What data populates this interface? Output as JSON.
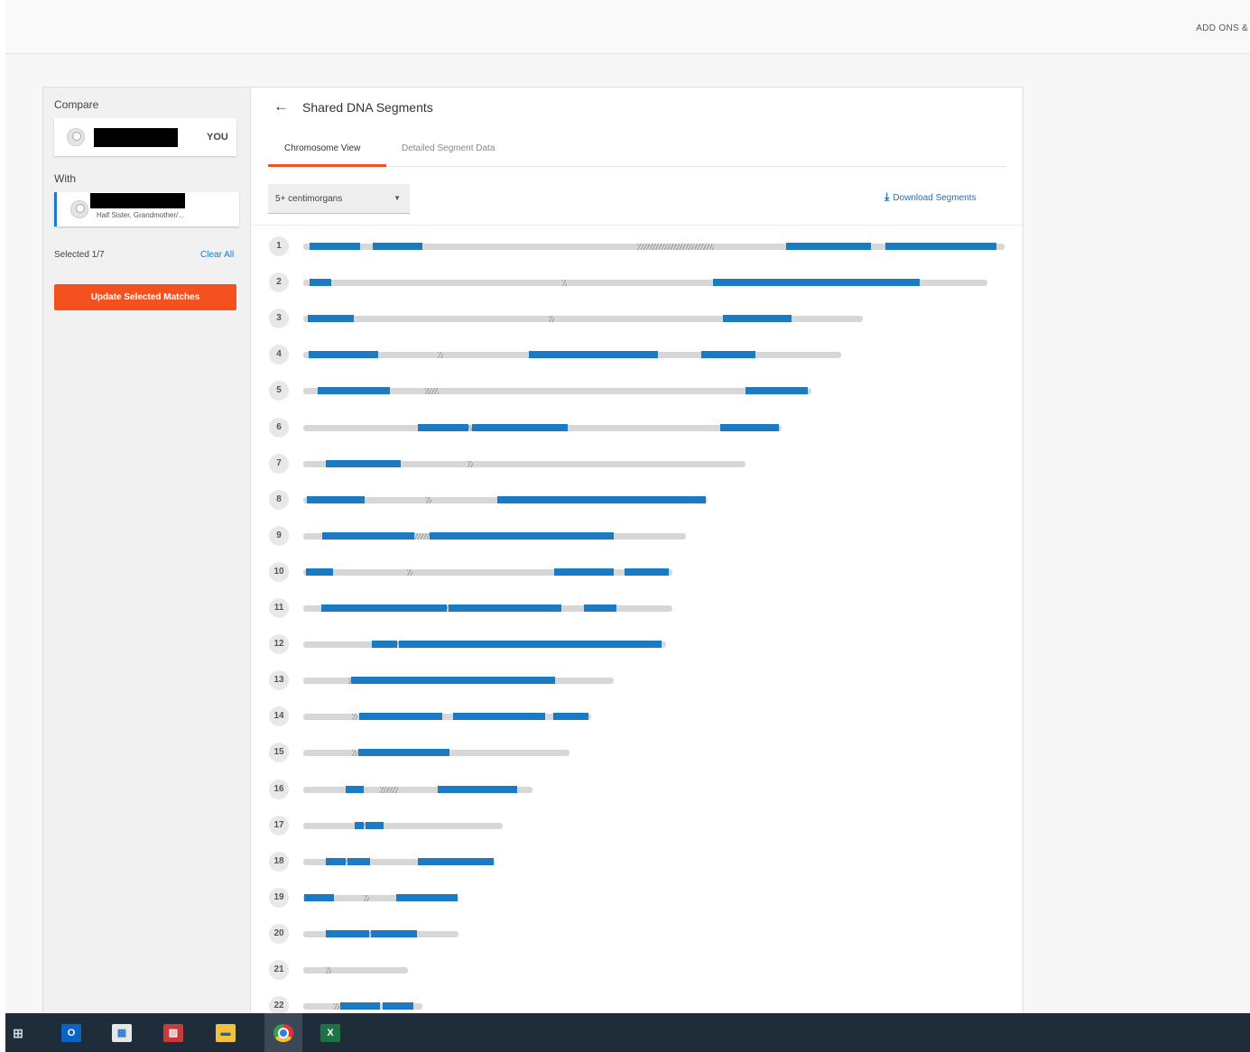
{
  "header": {
    "addons_label": "ADD ONS &"
  },
  "compare": {
    "compare_label": "Compare",
    "you_label": "YOU",
    "with_label": "With",
    "relationship": "Half Sister, Grandmother/...",
    "selected_count": "Selected 1/7",
    "clear_all": "Clear All",
    "update_button": "Update Selected Matches"
  },
  "main": {
    "title": "Shared DNA Segments",
    "tabs": [
      {
        "label": "Chromosome View"
      },
      {
        "label": "Detailed Segment Data"
      }
    ],
    "filter_value": "5+ centimorgans",
    "download_label": "Download Segments"
  },
  "icons": {
    "back": "arrow-left-icon",
    "dropdown": "caret-down-icon",
    "download": "download-icon"
  },
  "colors": {
    "accent": "#f4511e",
    "segment": "#1a7bc4",
    "link": "#1f7bc2"
  },
  "taskbar": {
    "outlook_label": "O",
    "excel_label": "X"
  },
  "chart_data": {
    "type": "chromosome-browser",
    "chromosomes": [
      {
        "label": "1",
        "length": 777,
        "centromere": [
          370,
          455
        ],
        "segments": [
          [
            7,
            63
          ],
          [
            77,
            132
          ],
          [
            535,
            629
          ],
          [
            645,
            768
          ]
        ]
      },
      {
        "label": "2",
        "length": 758,
        "centromere": [
          287,
          292
        ],
        "segments": [
          [
            7,
            31
          ],
          [
            454,
            683
          ]
        ]
      },
      {
        "label": "3",
        "length": 620,
        "centromere": [
          272,
          278
        ],
        "segments": [
          [
            5,
            56
          ],
          [
            465,
            541
          ]
        ]
      },
      {
        "label": "4",
        "length": 596,
        "centromere": [
          149,
          155
        ],
        "segments": [
          [
            6,
            83
          ],
          [
            250,
            393
          ],
          [
            441,
            501
          ]
        ]
      },
      {
        "label": "5",
        "length": 563,
        "centromere": [
          135,
          150
        ],
        "segments": [
          [
            16,
            96
          ],
          [
            490,
            559
          ]
        ]
      },
      {
        "label": "6",
        "length": 530,
        "centromere": [
          178,
          188
        ],
        "segments": [
          [
            127,
            183
          ],
          [
            187,
            293
          ],
          [
            462,
            527
          ]
        ]
      },
      {
        "label": "7",
        "length": 490,
        "centromere": [
          182,
          188
        ],
        "segments": [
          [
            25,
            108
          ]
        ]
      },
      {
        "label": "8",
        "length": 448,
        "centromere": [
          136,
          142
        ],
        "segments": [
          [
            4,
            68
          ],
          [
            215,
            446
          ]
        ]
      },
      {
        "label": "9",
        "length": 424,
        "centromere": [
          123,
          140
        ],
        "segments": [
          [
            21,
            123
          ],
          [
            140,
            344
          ]
        ]
      },
      {
        "label": "10",
        "length": 409,
        "centromere": [
          115,
          121
        ],
        "segments": [
          [
            3,
            33
          ],
          [
            278,
            344
          ],
          [
            356,
            405
          ]
        ]
      },
      {
        "label": "11",
        "length": 409,
        "centromere": [
          157,
          163
        ],
        "segments": [
          [
            20,
            159
          ],
          [
            161,
            286
          ],
          [
            311,
            347
          ]
        ]
      },
      {
        "label": "12",
        "length": 402,
        "centromere": [
          102,
          108
        ],
        "segments": [
          [
            76,
            104
          ],
          [
            106,
            397
          ]
        ]
      },
      {
        "label": "13",
        "length": 344,
        "centromere": [
          50,
          56
        ],
        "segments": [
          [
            53,
            279
          ]
        ]
      },
      {
        "label": "14",
        "length": 319,
        "centromere": [
          54,
          60
        ],
        "segments": [
          [
            62,
            154
          ],
          [
            166,
            268
          ],
          [
            277,
            316
          ]
        ]
      },
      {
        "label": "15",
        "length": 295,
        "centromere": [
          54,
          60
        ],
        "segments": [
          [
            61,
            162
          ]
        ]
      },
      {
        "label": "16",
        "length": 254,
        "centromere": [
          85,
          105
        ],
        "segments": [
          [
            47,
            67
          ],
          [
            149,
            237
          ]
        ]
      },
      {
        "label": "17",
        "length": 221,
        "centromere": [
          65,
          71
        ],
        "segments": [
          [
            57,
            67
          ],
          [
            69,
            89
          ]
        ]
      },
      {
        "label": "18",
        "length": 212,
        "centromere": [
          45,
          51
        ],
        "segments": [
          [
            25,
            47
          ],
          [
            49,
            74
          ],
          [
            127,
            211
          ]
        ]
      },
      {
        "label": "19",
        "length": 172,
        "centromere": [
          67,
          73
        ],
        "segments": [
          [
            1,
            34
          ],
          [
            103,
            171
          ]
        ]
      },
      {
        "label": "20",
        "length": 172,
        "centromere": [
          71,
          77
        ],
        "segments": [
          [
            25,
            73
          ],
          [
            75,
            126
          ]
        ]
      },
      {
        "label": "21",
        "length": 116,
        "centromere": [
          25,
          31
        ],
        "segments": []
      },
      {
        "label": "22",
        "length": 132,
        "centromere": [
          34,
          40
        ],
        "segments": [
          [
            41,
            85
          ],
          [
            88,
            122
          ]
        ]
      }
    ]
  }
}
